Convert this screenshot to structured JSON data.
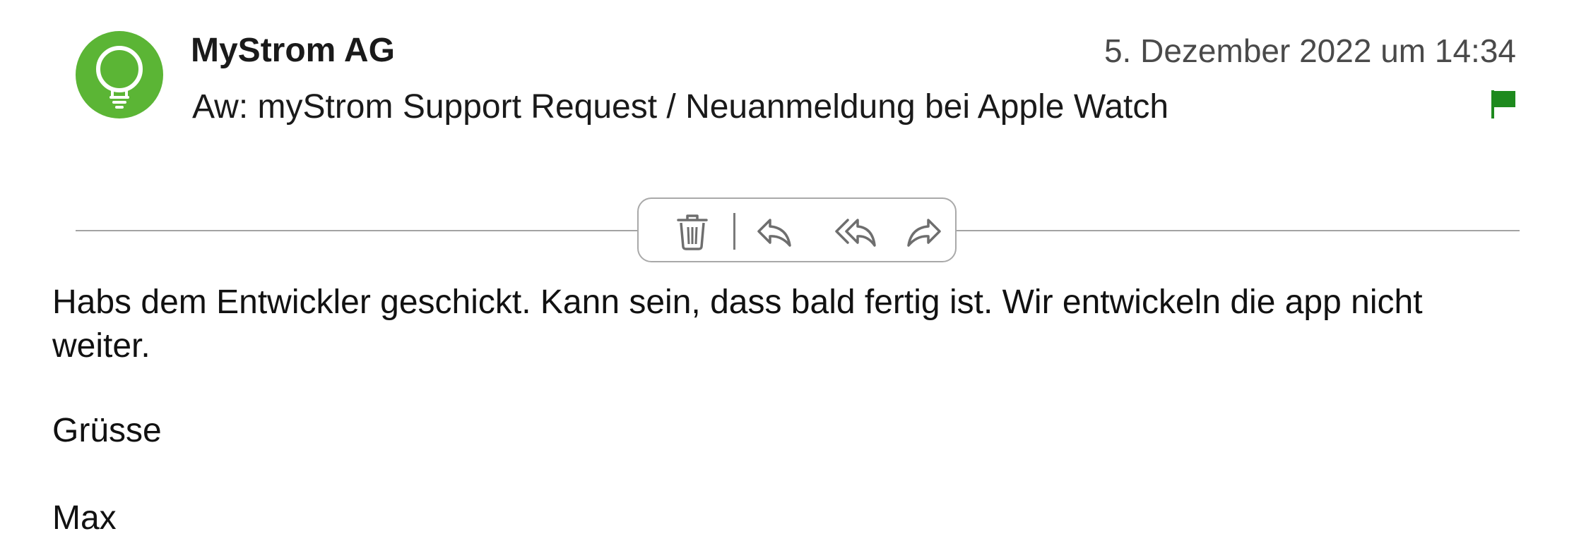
{
  "message": {
    "sender": "MyStrom AG",
    "date": "5. Dezember 2022 um 14:34",
    "subject": "Aw: myStrom Support Request / Neuanmeldung bei Apple Watch",
    "flagged": true,
    "flag_color": "#1e8a1e",
    "avatar": {
      "icon": "lightbulb-icon",
      "background_color": "#5bb535"
    }
  },
  "toolbar": {
    "actions": [
      {
        "id": "delete",
        "icon": "trash-icon"
      },
      {
        "id": "reply",
        "icon": "reply-icon"
      },
      {
        "id": "reply_all",
        "icon": "reply-all-icon"
      },
      {
        "id": "forward",
        "icon": "forward-icon"
      }
    ]
  },
  "body": {
    "paragraphs": [
      "Habs dem Entwickler geschickt. Kann sein, dass bald fertig ist. Wir entwickeln die app nicht weiter.",
      "Grüsse",
      "Max"
    ]
  }
}
